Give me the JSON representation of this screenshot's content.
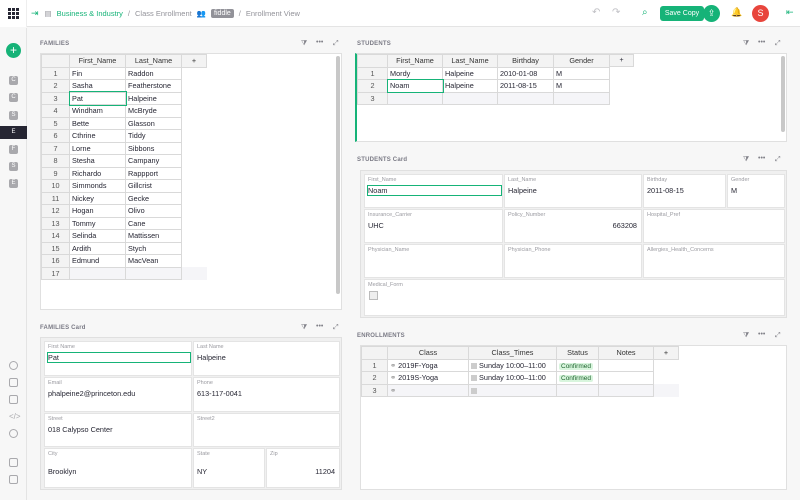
{
  "topbar": {
    "breadcrumb_doc": "Business & Industry",
    "breadcrumb_page": "Class Enrollment",
    "user_tag": "fiddle",
    "view": "Enrollment View",
    "save_copy": "Save Copy",
    "avatar_letter": "S",
    "brand_green": "#16b378"
  },
  "sidebar": {
    "add_label": "+",
    "pages": [
      "C",
      "C",
      "S",
      "E",
      "F",
      "S",
      "E"
    ]
  },
  "families": {
    "title": "FAMILIES",
    "columns": [
      "First_Name",
      "Last_Name",
      "+"
    ],
    "rows": [
      [
        "1",
        "Fin",
        "Raddon"
      ],
      [
        "2",
        "Sasha",
        "Featherstone"
      ],
      [
        "3",
        "Pat",
        "Halpeine"
      ],
      [
        "4",
        "Windham",
        "McBryde"
      ],
      [
        "5",
        "Bette",
        "Glasson"
      ],
      [
        "6",
        "Cthrine",
        "Tiddy"
      ],
      [
        "7",
        "Lorne",
        "Sibbons"
      ],
      [
        "8",
        "Stesha",
        "Campany"
      ],
      [
        "9",
        "Richardo",
        "Rappport"
      ],
      [
        "10",
        "Simmonds",
        "Gillcrist"
      ],
      [
        "11",
        "Nickey",
        "Gecke"
      ],
      [
        "12",
        "Hogan",
        "Olivo"
      ],
      [
        "13",
        "Tommy",
        "Cane"
      ],
      [
        "14",
        "Selinda",
        "Mattissen"
      ],
      [
        "15",
        "Ardith",
        "Stych"
      ],
      [
        "16",
        "Edmund",
        "MacVean"
      ],
      [
        "17",
        "",
        ""
      ]
    ]
  },
  "students": {
    "title": "STUDENTS",
    "columns": [
      "First_Name",
      "Last_Name",
      "Birthday",
      "Gender",
      "+"
    ],
    "rows": [
      [
        "1",
        "Mordy",
        "Halpeine",
        "2010-01-08",
        "M"
      ],
      [
        "2",
        "Noam",
        "Halpeine",
        "2011-08-15",
        "M"
      ],
      [
        "3",
        "",
        "",
        "",
        ""
      ]
    ]
  },
  "students_card": {
    "title": "STUDENTS Card",
    "f1": {
      "label": "First_Name",
      "value": "Noam"
    },
    "f2": {
      "label": "Last_Name",
      "value": "Halpeine"
    },
    "f3": {
      "label": "Birthday",
      "value": "2011-08-15"
    },
    "f4": {
      "label": "Gender",
      "value": "M"
    },
    "f5": {
      "label": "Insurance_Carrier",
      "value": "UHC"
    },
    "f6": {
      "label": "Policy_Number",
      "value": "663208"
    },
    "f7": {
      "label": "Hospital_Pref",
      "value": ""
    },
    "f8": {
      "label": "Physician_Name",
      "value": ""
    },
    "f9": {
      "label": "Physician_Phone",
      "value": ""
    },
    "f10": {
      "label": "Allergies_Health_Concerns",
      "value": ""
    },
    "f11": {
      "label": "Medical_Form",
      "value": ""
    }
  },
  "families_card": {
    "title": "FAMILIES Card",
    "f1": {
      "label": "First Name",
      "value": "Pat"
    },
    "f2": {
      "label": "Last Name",
      "value": "Halpeine"
    },
    "f3": {
      "label": "Email",
      "value": "phalpeine2@princeton.edu"
    },
    "f4": {
      "label": "Phone",
      "value": "613-117-0041"
    },
    "f5": {
      "label": "Street",
      "value": "018 Calypso Center"
    },
    "f6": {
      "label": "Street2",
      "value": ""
    },
    "f7": {
      "label": "City",
      "value": "Brooklyn"
    },
    "f8": {
      "label": "State",
      "value": "NY"
    },
    "f9": {
      "label": "Zip",
      "value": "11204"
    }
  },
  "enrollments": {
    "title": "ENROLLMENTS",
    "columns": [
      "Class",
      "Class_Times",
      "Status",
      "Notes",
      "+"
    ],
    "rows": [
      [
        "1",
        "2019F-Yoga",
        "Sunday 10:00–11:00",
        "Confirmed",
        ""
      ],
      [
        "2",
        "2019S-Yoga",
        "Sunday 10:00–11:00",
        "Confirmed",
        ""
      ],
      [
        "3",
        "",
        "",
        "",
        ""
      ]
    ]
  }
}
